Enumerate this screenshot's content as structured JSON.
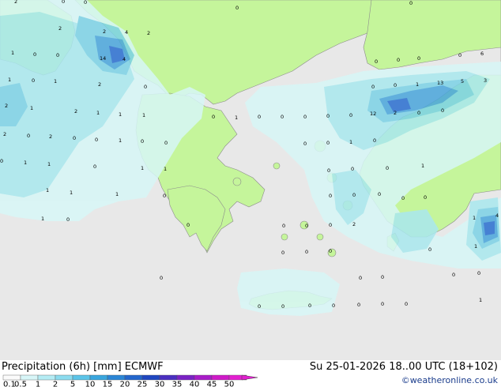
{
  "title": "Precipitation (6h) [mm] ECMWF",
  "valid_time": "Su 25-01-2026 18..00 UTC (18+102)",
  "credit": "©weatheronline.co.uk",
  "colors": {
    "sea": "#e8e8e8",
    "land": "#c5f59b",
    "border": "#8c8c8c",
    "pale": "#d7f7f7",
    "light": "#a9e8ef",
    "medium": "#7dd2e6",
    "dark": "#4aa6dc",
    "deep": "#2a6fd0",
    "deepest": "#1a3fb0"
  },
  "legend": {
    "labels": [
      "0.1",
      "0.5",
      "1",
      "2",
      "5",
      "10",
      "15",
      "20",
      "25",
      "30",
      "35",
      "40",
      "45",
      "50"
    ],
    "colors": [
      "#fbfbfb",
      "#d8f6f8",
      "#b5ecf4",
      "#8cdcef",
      "#5cc4e8",
      "#3aa6de",
      "#2b86d6",
      "#2366cc",
      "#1f46c0",
      "#4a2fc0",
      "#7a22c4",
      "#a81cc8",
      "#cf1ac8",
      "#e31fd0"
    ]
  },
  "grid_values": [
    {
      "t": "2"
    },
    {
      "t": "0"
    },
    {
      "t": "0"
    },
    {
      "t": "0"
    },
    {
      "t": "2"
    },
    {
      "t": "2"
    },
    {
      "t": "4"
    },
    {
      "t": "2"
    },
    {
      "t": "1"
    },
    {
      "t": "0"
    },
    {
      "t": "0"
    },
    {
      "t": "14"
    },
    {
      "t": "4"
    },
    {
      "t": "1"
    },
    {
      "t": "0"
    },
    {
      "t": "1"
    },
    {
      "t": "2"
    },
    {
      "t": "0"
    },
    {
      "t": "2"
    },
    {
      "t": "1"
    },
    {
      "t": "2"
    },
    {
      "t": "1"
    },
    {
      "t": "1"
    },
    {
      "t": "1"
    },
    {
      "t": "0"
    },
    {
      "t": "1"
    },
    {
      "t": "0"
    },
    {
      "t": "0"
    },
    {
      "t": "2"
    },
    {
      "t": "0"
    },
    {
      "t": "2"
    },
    {
      "t": "0"
    },
    {
      "t": "0"
    },
    {
      "t": "1"
    },
    {
      "t": "0"
    },
    {
      "t": "0"
    },
    {
      "t": "0"
    },
    {
      "t": "1"
    },
    {
      "t": "1"
    },
    {
      "t": "1"
    },
    {
      "t": "1"
    },
    {
      "t": "0"
    },
    {
      "t": "0"
    },
    {
      "t": "0"
    },
    {
      "t": "0"
    },
    {
      "t": "0"
    },
    {
      "t": "0"
    },
    {
      "t": "0"
    },
    {
      "t": "0"
    },
    {
      "t": "0"
    },
    {
      "t": "0"
    },
    {
      "t": "6"
    },
    {
      "t": "0"
    },
    {
      "t": "1"
    },
    {
      "t": "13"
    },
    {
      "t": "5"
    },
    {
      "t": "3"
    },
    {
      "t": "0"
    },
    {
      "t": "12"
    },
    {
      "t": "2"
    },
    {
      "t": "0"
    },
    {
      "t": "0"
    },
    {
      "t": "0"
    },
    {
      "t": "1"
    },
    {
      "t": "1"
    },
    {
      "t": "0"
    },
    {
      "t": "0"
    },
    {
      "t": "0"
    },
    {
      "t": "1"
    },
    {
      "t": "0"
    },
    {
      "t": "0"
    },
    {
      "t": "1"
    },
    {
      "t": "2"
    },
    {
      "t": "0"
    },
    {
      "t": "0"
    },
    {
      "t": "0"
    },
    {
      "t": "1"
    },
    {
      "t": "4"
    },
    {
      "t": "1"
    },
    {
      "t": "0"
    },
    {
      "t": "0"
    },
    {
      "t": "0"
    },
    {
      "t": "0"
    },
    {
      "t": "0"
    },
    {
      "t": "0"
    },
    {
      "t": "1"
    },
    {
      "t": "0"
    },
    {
      "t": "1"
    },
    {
      "t": "0"
    },
    {
      "t": "0"
    },
    {
      "t": "0"
    },
    {
      "t": "0"
    },
    {
      "t": "0"
    },
    {
      "t": "0"
    },
    {
      "t": "0"
    },
    {
      "t": "0"
    },
    {
      "t": "0"
    },
    {
      "t": "0"
    },
    {
      "t": "0"
    },
    {
      "t": "0"
    },
    {
      "t": "0"
    },
    {
      "t": "0"
    },
    {
      "t": "0"
    },
    {
      "t": "0"
    },
    {
      "t": "1"
    }
  ]
}
